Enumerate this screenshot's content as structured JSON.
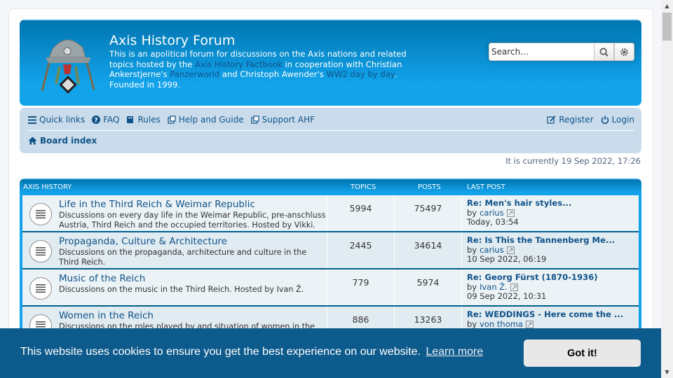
{
  "header": {
    "title": "Axis History Forum",
    "desc_1": "This is an apolitical forum for discussions on the Axis nations and related topics hosted by the ",
    "link_factbook": "Axis History Factbook",
    "desc_2": " in cooperation with Christian Ankerstjerne's ",
    "link_panzerworld": "Panzerworld",
    "desc_3": " and Christoph Awender's ",
    "link_ww2": "WW2 day by day",
    "desc_4": ". Founded in 1999."
  },
  "search": {
    "placeholder": "Search…"
  },
  "nav": {
    "quick_links": "Quick links",
    "faq": "FAQ",
    "rules": "Rules",
    "help": "Help and Guide",
    "support": "Support AHF",
    "register": "Register",
    "login": "Login",
    "board_index": "Board index"
  },
  "current_time": "It is currently 19 Sep 2022, 17:26",
  "table": {
    "section": "AXIS HISTORY",
    "col_topics": "TOPICS",
    "col_posts": "POSTS",
    "col_last": "LAST POST"
  },
  "forums": [
    {
      "title": "Life in the Third Reich & Weimar Republic",
      "desc": "Discussions on every day life in the Weimar Republic, pre-anschluss Austria, Third Reich and the occupied territories. Hosted by Vikki.",
      "topics": "5994",
      "posts": "75497",
      "last_title": "Re: Men's hair styles...",
      "last_by": "by",
      "last_user": "carius",
      "last_time": "Today, 03:54"
    },
    {
      "title": "Propaganda, Culture & Architecture",
      "desc": "Discussions on the propaganda, architecture and culture in the Third Reich.",
      "topics": "2445",
      "posts": "34614",
      "last_title": "Re: Is This the Tannenberg Me...",
      "last_by": "by",
      "last_user": "carius",
      "last_time": "10 Sep 2022, 06:19"
    },
    {
      "title": "Music of the Reich",
      "desc": "Discussions on the music in the Third Reich. Hosted by Ivan Ž.",
      "topics": "779",
      "posts": "5974",
      "last_title": "Re: Georg Fürst (1870-1936)",
      "last_by": "by",
      "last_user": "Ivan Ž.",
      "last_time": "09 Sep 2022, 10:31"
    },
    {
      "title": "Women in the Reich",
      "desc": "Discussions on the roles played by and situation of women in the",
      "topics": "886",
      "posts": "13263",
      "last_title": "Re: WEDDINGS - Here come the ...",
      "last_by": "by",
      "last_user": "von thoma",
      "last_time": ""
    }
  ],
  "cookie": {
    "text": "This website uses cookies to ensure you get the best experience on our website.",
    "learn_more": "Learn more",
    "button": "Got it!"
  },
  "colors": {
    "header_blue": "#12a3eb",
    "nav_bg": "#cadceb",
    "link": "#105289",
    "cookie_bg": "#0d5a8c"
  }
}
